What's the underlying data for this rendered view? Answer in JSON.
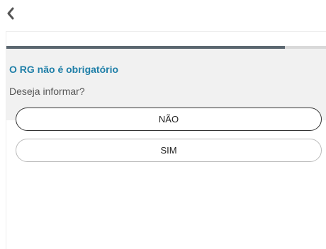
{
  "nav": {
    "back_icon": "chevron-left-icon"
  },
  "progress": {
    "fraction": 0.87
  },
  "prompt": {
    "title": "O RG não é obrigatório",
    "subtitle": "Deseja informar?"
  },
  "options": {
    "no_label": "NÃO",
    "yes_label": "SIM"
  },
  "colors": {
    "title": "#1f7fa8",
    "progress_fill": "#5b6770",
    "progress_track": "#d9d9d9",
    "panel_background": "#f1f1f1"
  }
}
